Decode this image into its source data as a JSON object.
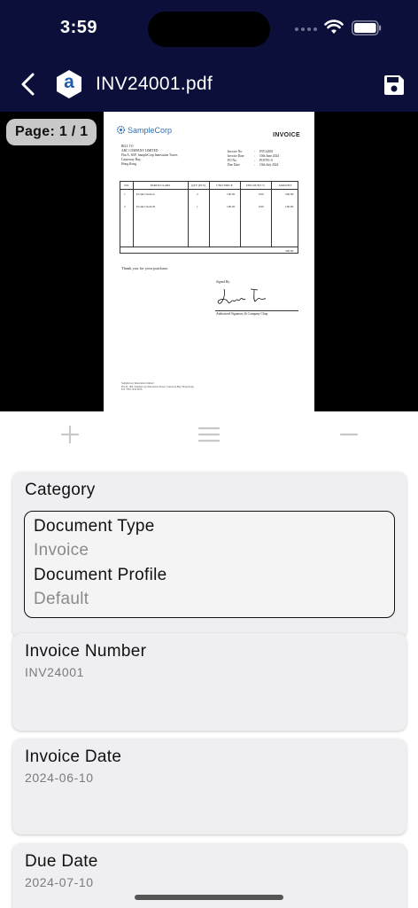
{
  "status_bar": {
    "time": "3:59"
  },
  "nav": {
    "title": "INV24001.pdf",
    "file_badge_letter": "a"
  },
  "viewer": {
    "page_indicator": "Page: 1 / 1",
    "document": {
      "logo_text": "SampleCorp",
      "heading": "INVOICE",
      "bill_to": [
        "BILL TO",
        "ABC COMPANY LIMITED",
        "Flat A, 30/F, SampleCorp Innovation Tower,",
        "Causeway Bay,",
        "Hong Kong"
      ],
      "meta": [
        {
          "label": "Invoice No.",
          "value": "INV24001"
        },
        {
          "label": "Invoice Date",
          "value": "10th June 2024"
        },
        {
          "label": "PO No.",
          "value": "PO5701-0"
        },
        {
          "label": "Due Date",
          "value": "10th July 2024"
        }
      ],
      "table_headers": [
        "NO.",
        "PARTICULARS",
        "QTY (PCS)",
        "UNIT PRICE",
        "DISCOUNT %",
        "AMOUNT"
      ],
      "rows": [
        [
          "1",
          "Product Item A",
          "2",
          "100.00",
          "0.00",
          "200.00"
        ],
        [
          "2",
          "Product Item B",
          "1",
          "100.00",
          "0.00",
          "100.00"
        ]
      ],
      "total": "300.00",
      "thanks": "Thank you for your purchase.",
      "signed_by": "Signed By:",
      "signature_caption": "Authorized Signatory & Company Chop",
      "footer": [
        "SampleCorp Innovation Limited",
        "Flat D, 18/F, SampleCorp Innovation Tower, Causeway Bay, Hong Kong",
        "Tel: +852 1234 5678"
      ]
    }
  },
  "toolbar": {
    "zoom_in_icon": "plus-icon",
    "menu_icon": "menu-icon",
    "zoom_out_icon": "minus-icon"
  },
  "category": {
    "heading": "Category",
    "document_type_label": "Document Type",
    "document_type_value": "Invoice",
    "document_profile_label": "Document Profile",
    "document_profile_value": "Default"
  },
  "fields": [
    {
      "label": "Invoice Number",
      "value": "INV24001"
    },
    {
      "label": "Invoice Date",
      "value": "2024-06-10"
    },
    {
      "label": "Due Date",
      "value": "2024-07-10"
    }
  ],
  "colors": {
    "header_bg": "#0b0f3a",
    "card_bg": "#efeff2",
    "value_text": "#7a7a7a"
  }
}
